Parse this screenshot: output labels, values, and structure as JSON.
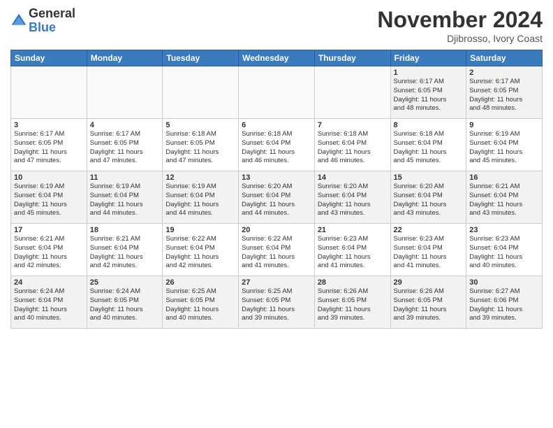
{
  "logo": {
    "line1": "General",
    "line2": "Blue"
  },
  "title": "November 2024",
  "location": "Djibrosso, Ivory Coast",
  "headers": [
    "Sunday",
    "Monday",
    "Tuesday",
    "Wednesday",
    "Thursday",
    "Friday",
    "Saturday"
  ],
  "weeks": [
    [
      {
        "day": "",
        "info": ""
      },
      {
        "day": "",
        "info": ""
      },
      {
        "day": "",
        "info": ""
      },
      {
        "day": "",
        "info": ""
      },
      {
        "day": "",
        "info": ""
      },
      {
        "day": "1",
        "info": "Sunrise: 6:17 AM\nSunset: 6:05 PM\nDaylight: 11 hours\nand 48 minutes."
      },
      {
        "day": "2",
        "info": "Sunrise: 6:17 AM\nSunset: 6:05 PM\nDaylight: 11 hours\nand 48 minutes."
      }
    ],
    [
      {
        "day": "3",
        "info": "Sunrise: 6:17 AM\nSunset: 6:05 PM\nDaylight: 11 hours\nand 47 minutes."
      },
      {
        "day": "4",
        "info": "Sunrise: 6:17 AM\nSunset: 6:05 PM\nDaylight: 11 hours\nand 47 minutes."
      },
      {
        "day": "5",
        "info": "Sunrise: 6:18 AM\nSunset: 6:05 PM\nDaylight: 11 hours\nand 47 minutes."
      },
      {
        "day": "6",
        "info": "Sunrise: 6:18 AM\nSunset: 6:04 PM\nDaylight: 11 hours\nand 46 minutes."
      },
      {
        "day": "7",
        "info": "Sunrise: 6:18 AM\nSunset: 6:04 PM\nDaylight: 11 hours\nand 46 minutes."
      },
      {
        "day": "8",
        "info": "Sunrise: 6:18 AM\nSunset: 6:04 PM\nDaylight: 11 hours\nand 45 minutes."
      },
      {
        "day": "9",
        "info": "Sunrise: 6:19 AM\nSunset: 6:04 PM\nDaylight: 11 hours\nand 45 minutes."
      }
    ],
    [
      {
        "day": "10",
        "info": "Sunrise: 6:19 AM\nSunset: 6:04 PM\nDaylight: 11 hours\nand 45 minutes."
      },
      {
        "day": "11",
        "info": "Sunrise: 6:19 AM\nSunset: 6:04 PM\nDaylight: 11 hours\nand 44 minutes."
      },
      {
        "day": "12",
        "info": "Sunrise: 6:19 AM\nSunset: 6:04 PM\nDaylight: 11 hours\nand 44 minutes."
      },
      {
        "day": "13",
        "info": "Sunrise: 6:20 AM\nSunset: 6:04 PM\nDaylight: 11 hours\nand 44 minutes."
      },
      {
        "day": "14",
        "info": "Sunrise: 6:20 AM\nSunset: 6:04 PM\nDaylight: 11 hours\nand 43 minutes."
      },
      {
        "day": "15",
        "info": "Sunrise: 6:20 AM\nSunset: 6:04 PM\nDaylight: 11 hours\nand 43 minutes."
      },
      {
        "day": "16",
        "info": "Sunrise: 6:21 AM\nSunset: 6:04 PM\nDaylight: 11 hours\nand 43 minutes."
      }
    ],
    [
      {
        "day": "17",
        "info": "Sunrise: 6:21 AM\nSunset: 6:04 PM\nDaylight: 11 hours\nand 42 minutes."
      },
      {
        "day": "18",
        "info": "Sunrise: 6:21 AM\nSunset: 6:04 PM\nDaylight: 11 hours\nand 42 minutes."
      },
      {
        "day": "19",
        "info": "Sunrise: 6:22 AM\nSunset: 6:04 PM\nDaylight: 11 hours\nand 42 minutes."
      },
      {
        "day": "20",
        "info": "Sunrise: 6:22 AM\nSunset: 6:04 PM\nDaylight: 11 hours\nand 41 minutes."
      },
      {
        "day": "21",
        "info": "Sunrise: 6:23 AM\nSunset: 6:04 PM\nDaylight: 11 hours\nand 41 minutes."
      },
      {
        "day": "22",
        "info": "Sunrise: 6:23 AM\nSunset: 6:04 PM\nDaylight: 11 hours\nand 41 minutes."
      },
      {
        "day": "23",
        "info": "Sunrise: 6:23 AM\nSunset: 6:04 PM\nDaylight: 11 hours\nand 40 minutes."
      }
    ],
    [
      {
        "day": "24",
        "info": "Sunrise: 6:24 AM\nSunset: 6:04 PM\nDaylight: 11 hours\nand 40 minutes."
      },
      {
        "day": "25",
        "info": "Sunrise: 6:24 AM\nSunset: 6:05 PM\nDaylight: 11 hours\nand 40 minutes."
      },
      {
        "day": "26",
        "info": "Sunrise: 6:25 AM\nSunset: 6:05 PM\nDaylight: 11 hours\nand 40 minutes."
      },
      {
        "day": "27",
        "info": "Sunrise: 6:25 AM\nSunset: 6:05 PM\nDaylight: 11 hours\nand 39 minutes."
      },
      {
        "day": "28",
        "info": "Sunrise: 6:26 AM\nSunset: 6:05 PM\nDaylight: 11 hours\nand 39 minutes."
      },
      {
        "day": "29",
        "info": "Sunrise: 6:26 AM\nSunset: 6:05 PM\nDaylight: 11 hours\nand 39 minutes."
      },
      {
        "day": "30",
        "info": "Sunrise: 6:27 AM\nSunset: 6:06 PM\nDaylight: 11 hours\nand 39 minutes."
      }
    ]
  ]
}
